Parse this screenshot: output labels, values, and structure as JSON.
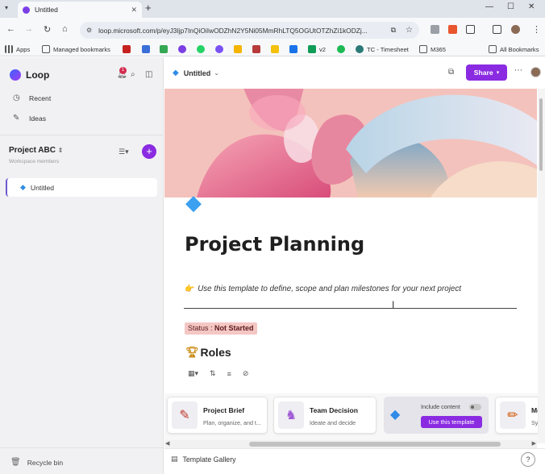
{
  "browser": {
    "tab_title": "Untitled",
    "url": "loop.microsoft.com/p/eyJ3Ijp7InQiOiIwODZhN2Y5Ni05MmRhLTQ5OGUtOTZhZi1kODZj...",
    "bookmarks": [
      "Apps",
      "Managed bookmarks",
      "v2",
      "TC - Timesheet",
      "M365",
      "All Bookmarks"
    ]
  },
  "sidebar": {
    "app_name": "Loop",
    "notification_count": "1",
    "nav": [
      {
        "label": "Recent",
        "icon": "clock-icon"
      },
      {
        "label": "Ideas",
        "icon": "pen-icon"
      }
    ],
    "workspace": {
      "name": "Project ABC",
      "subtitle": "Workspace members"
    },
    "pages": [
      {
        "label": "Untitled",
        "icon": "gem-icon"
      }
    ],
    "recycle_label": "Recycle bin"
  },
  "topbar": {
    "doc_title": "Untitled",
    "share_label": "Share"
  },
  "page": {
    "title": "Project Planning",
    "intro": "Use this template to define, scope and plan milestones for your next project",
    "status_prefix": "Status : ",
    "status_value": "Not Started",
    "roles_heading": "Roles"
  },
  "templates": [
    {
      "name": "Project Brief",
      "desc": "Plan, organize, and t...",
      "icon": "clipboard-icon"
    },
    {
      "name": "Team Decision",
      "desc": "Ideate and decide",
      "icon": "unicorn-icon"
    },
    {
      "name": "Mee",
      "desc": "Sync",
      "icon": "pencil-icon"
    }
  ],
  "active_template": {
    "include_label": "Include content",
    "use_label": "Use this template"
  },
  "bottom": {
    "gallery_label": "Template Gallery",
    "help_label": "?"
  },
  "colors": {
    "accent": "#8a2be2",
    "status_bg": "#f4c7c4"
  }
}
